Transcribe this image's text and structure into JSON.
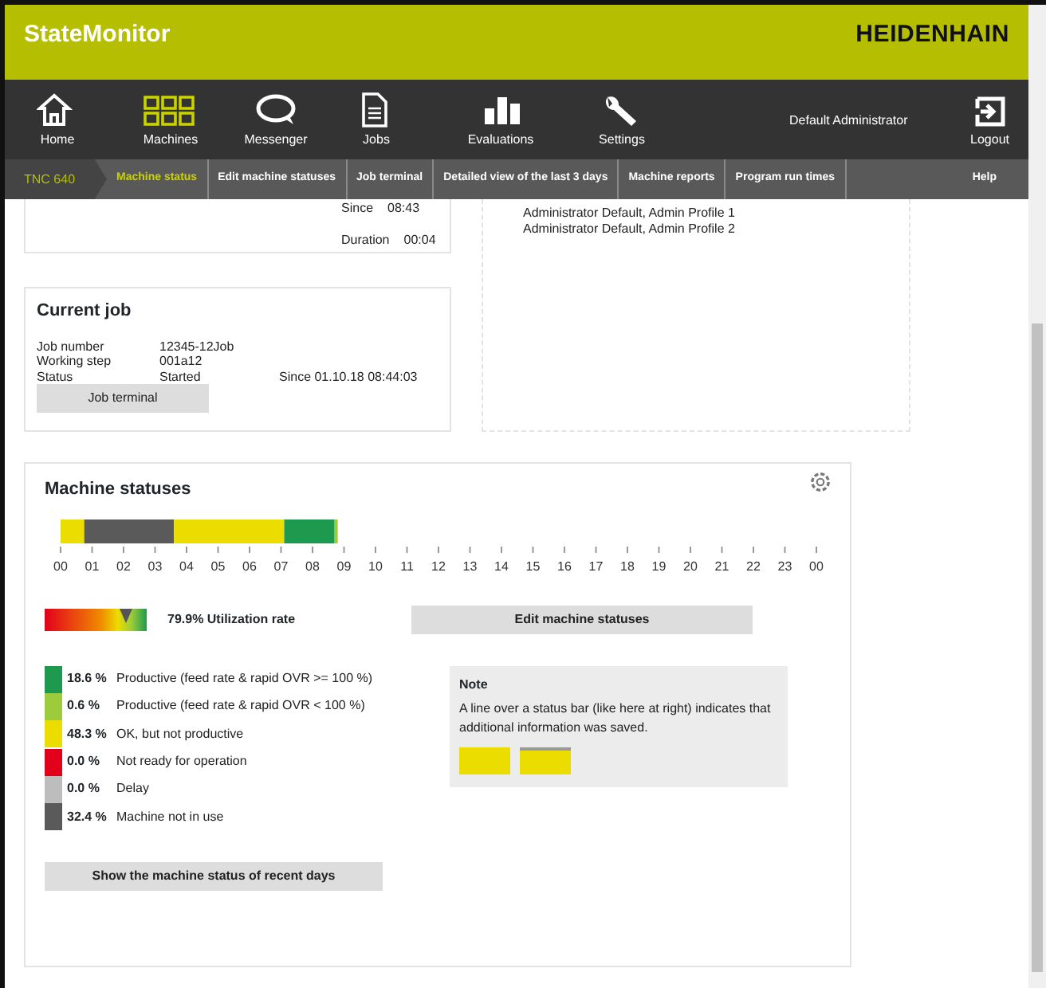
{
  "header": {
    "title": "StateMonitor",
    "brand": "HEIDENHAIN"
  },
  "nav": {
    "items": [
      {
        "label": "Home",
        "selected": false
      },
      {
        "label": "Machines",
        "selected": true
      },
      {
        "label": "Messenger",
        "selected": false
      },
      {
        "label": "Jobs",
        "selected": false
      },
      {
        "label": "Evaluations",
        "selected": false
      },
      {
        "label": "Settings",
        "selected": false
      }
    ],
    "user": "Default Administrator",
    "logout": "Logout"
  },
  "subnav": {
    "machine": "TNC 640",
    "tabs": [
      {
        "label": "Machine status",
        "selected": true
      },
      {
        "label": "Edit machine statuses",
        "selected": false
      },
      {
        "label": "Job terminal",
        "selected": false
      },
      {
        "label": "Detailed view of the last 3 days",
        "selected": false
      },
      {
        "label": "Machine reports",
        "selected": false
      },
      {
        "label": "Program run times",
        "selected": false
      }
    ],
    "help": "Help"
  },
  "machine_info": {
    "rows": [
      {
        "label": "Since",
        "value": "08:43"
      },
      {
        "label": "Duration",
        "value": "00:04"
      }
    ]
  },
  "current_job": {
    "title": "Current job",
    "rows": [
      {
        "label": "Job number",
        "value": "12345-12Job"
      },
      {
        "label": "Working step",
        "value": "001a12"
      },
      {
        "label": "Status",
        "value": "Started"
      }
    ],
    "since": "Since 01.10.18 08:44:03",
    "button": "Job terminal"
  },
  "profiles": {
    "lines": [
      "Administrator Default, Admin Profile 1",
      "Administrator Default, Admin Profile 2"
    ]
  },
  "machine_statuses": {
    "title": "Machine statuses",
    "chart_data": {
      "type": "bar",
      "orientation": "horizontal",
      "stacked": true,
      "xlim": [
        0,
        24
      ],
      "xticks": [
        {
          "value": 0,
          "label": "00"
        },
        {
          "value": 1,
          "label": "01"
        },
        {
          "value": 2,
          "label": "02"
        },
        {
          "value": 3,
          "label": "03"
        },
        {
          "value": 4,
          "label": "04"
        },
        {
          "value": 5,
          "label": "05"
        },
        {
          "value": 6,
          "label": "06"
        },
        {
          "value": 7,
          "label": "07"
        },
        {
          "value": 8,
          "label": "08"
        },
        {
          "value": 9,
          "label": "09"
        },
        {
          "value": 10,
          "label": "10"
        },
        {
          "value": 11,
          "label": "11"
        },
        {
          "value": 12,
          "label": "12"
        },
        {
          "value": 13,
          "label": "13"
        },
        {
          "value": 14,
          "label": "14"
        },
        {
          "value": 15,
          "label": "15"
        },
        {
          "value": 16,
          "label": "16"
        },
        {
          "value": 17,
          "label": "17"
        },
        {
          "value": 18,
          "label": "18"
        },
        {
          "value": 19,
          "label": "19"
        },
        {
          "value": 20,
          "label": "20"
        },
        {
          "value": 21,
          "label": "21"
        },
        {
          "value": 22,
          "label": "22"
        },
        {
          "value": 23,
          "label": "23"
        },
        {
          "value": 24,
          "label": "00"
        }
      ],
      "series": [
        {
          "color": "#ebdd00",
          "values": [
            0.75
          ]
        },
        {
          "color": "#5a5a5a",
          "values": [
            2.85
          ]
        },
        {
          "color": "#ebdd00",
          "values": [
            3.5
          ]
        },
        {
          "color": "#1d9a4d",
          "values": [
            1.6
          ]
        },
        {
          "color": "#9ccc3c",
          "values": [
            0.1
          ]
        }
      ]
    },
    "utilization": {
      "level": 0.799,
      "text": "79.9% Utilization rate"
    },
    "edit_button": "Edit machine statuses",
    "legend": [
      {
        "color": "#1d9a4d",
        "percent": "18.6 %",
        "label": "Productive (feed rate & rapid OVR >= 100 %)"
      },
      {
        "color": "#9ccc3c",
        "percent": "0.6 %",
        "label": "Productive (feed rate & rapid OVR < 100 %)"
      },
      {
        "color": "#ebdd00",
        "percent": "48.3 %",
        "label": "OK, but not productive"
      },
      {
        "color": "#e3001b",
        "percent": "0.0 %",
        "label": "Not ready for operation"
      },
      {
        "color": "#bdbdbd",
        "percent": "0.0 %",
        "label": "Delay"
      },
      {
        "color": "#5a5a5a",
        "percent": "32.4 %",
        "label": "Machine not in use"
      }
    ],
    "note": {
      "title": "Note",
      "text": "A line over a status bar (like here at right) indicates that additional information was saved.",
      "swatches": [
        {
          "line_over": false
        },
        {
          "line_over": true
        }
      ]
    },
    "history_button": "Show the machine status of recent days"
  }
}
